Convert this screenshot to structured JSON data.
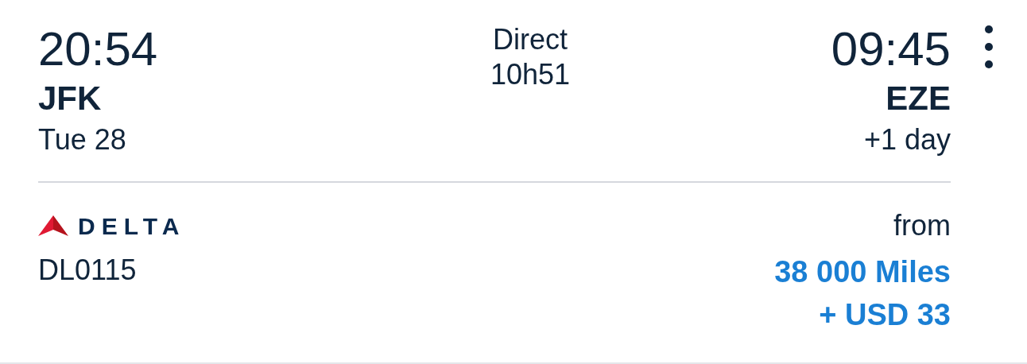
{
  "departure": {
    "time": "20:54",
    "airport": "JFK",
    "date": "Tue 28"
  },
  "duration": {
    "type": "Direct",
    "time": "10h51"
  },
  "arrival": {
    "time": "09:45",
    "airport": "EZE",
    "date": "+1 day"
  },
  "airline": {
    "name": "DELTA",
    "flight": "DL0115"
  },
  "price": {
    "label": "from",
    "miles": "38 000 Miles",
    "cash": "+ USD 33"
  }
}
